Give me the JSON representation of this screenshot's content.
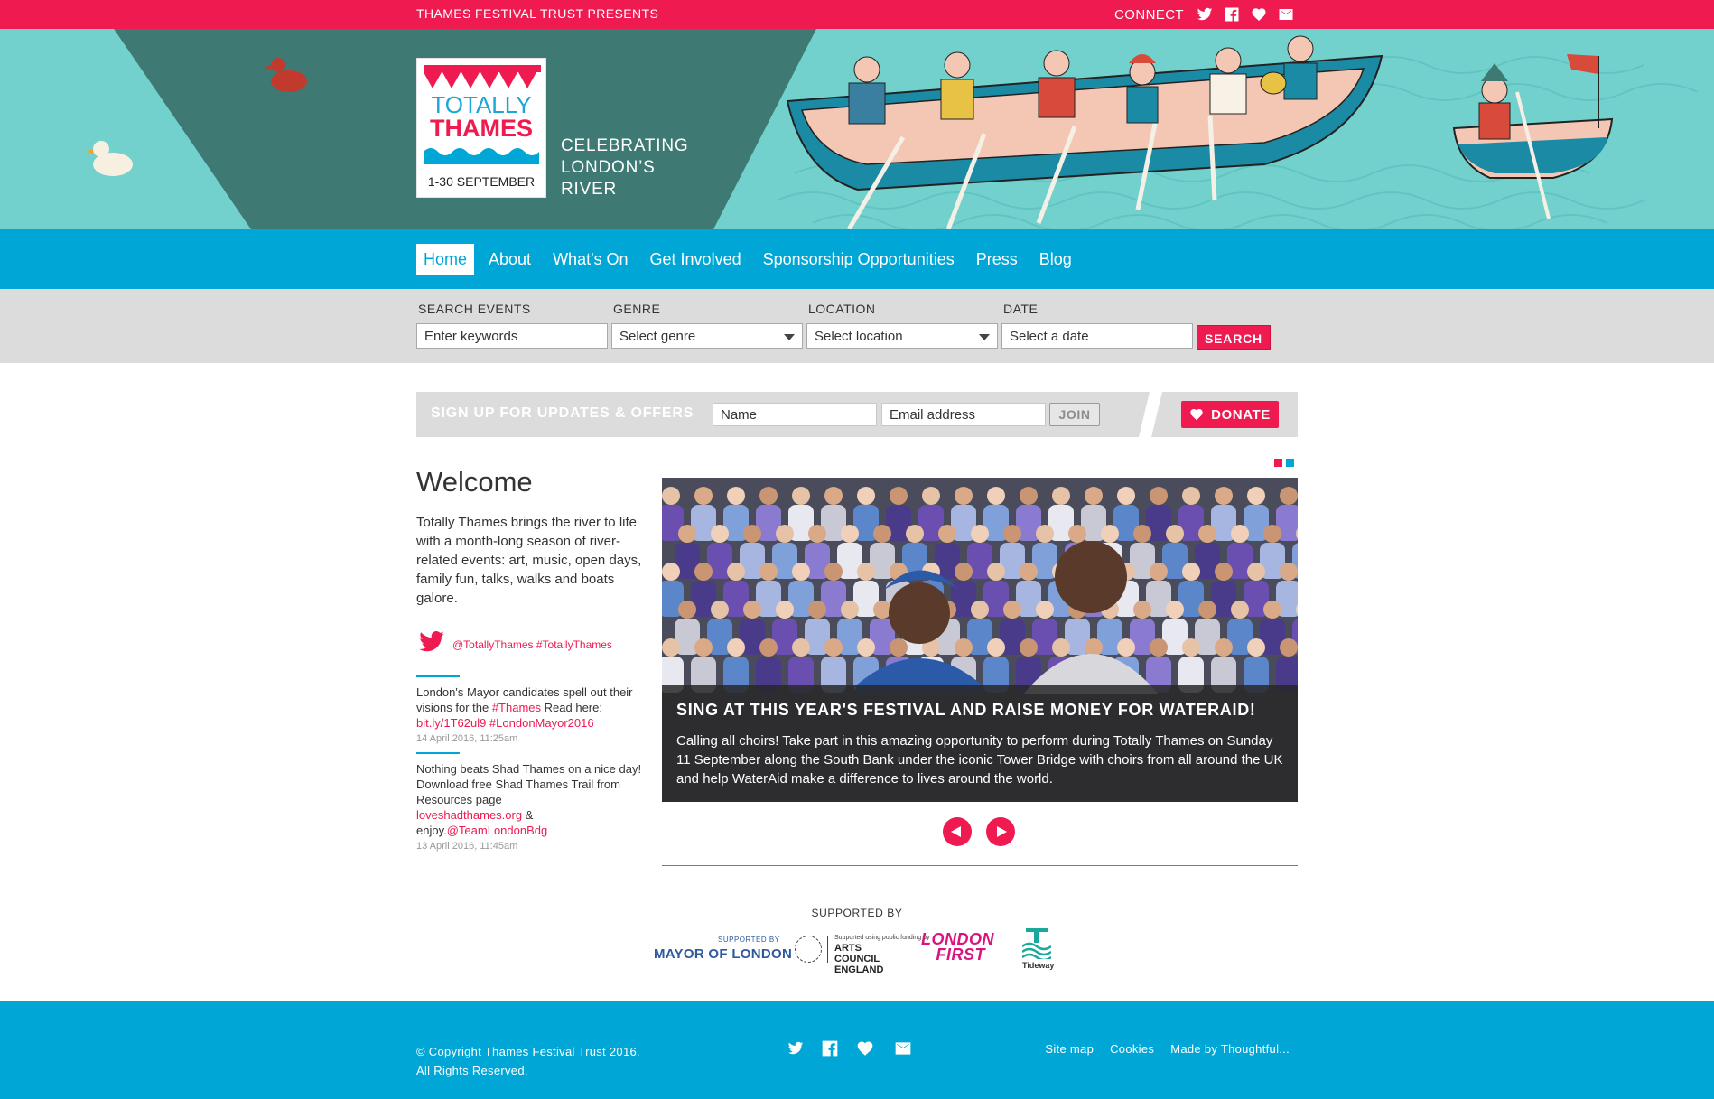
{
  "topbar": {
    "presents": "THAMES FESTIVAL TRUST PRESENTS",
    "connect_label": "CONNECT",
    "icons": [
      "twitter-icon",
      "facebook-icon",
      "heart-icon",
      "mail-icon"
    ]
  },
  "logo": {
    "line1": "TOTALLY",
    "line2": "THAMES",
    "dates": "1-30 SEPTEMBER"
  },
  "tagline": "CELEBRATING LONDON’S RIVER",
  "nav": {
    "items": [
      "Home",
      "About",
      "What's On",
      "Get Involved",
      "Sponsorship Opportunities",
      "Press",
      "Blog"
    ],
    "active": "Home"
  },
  "search": {
    "keywords_label": "SEARCH EVENTS",
    "keywords_placeholder": "Enter keywords",
    "genre_label": "GENRE",
    "genre_value": "Select genre",
    "location_label": "LOCATION",
    "location_value": "Select location",
    "date_label": "DATE",
    "date_placeholder": "Select a date",
    "button": "SEARCH"
  },
  "signup": {
    "title": "SIGN UP FOR UPDATES & OFFERS",
    "name_placeholder": "Name",
    "email_placeholder": "Email address",
    "join": "JOIN",
    "donate": "DONATE"
  },
  "welcome": {
    "title": "Welcome",
    "body": "Totally Thames brings the river to life with a month-long season of river-related events: art, music, open days, family fun, talks, walks and boats galore."
  },
  "twitter": {
    "handles": "@TotallyThames #TotallyThames",
    "tweets": [
      {
        "part1": "London's Mayor candidates spell out their visions for the ",
        "link1": "#Thames",
        "part2": " Read here: ",
        "link2": "bit.ly/1T62ul9 #LondonMayor2016",
        "date": "14 April 2016, 11:25am"
      },
      {
        "part1": "Nothing beats Shad Thames on a nice day! Download free Shad Thames Trail from Resources page ",
        "link1": "loveshadthames.org",
        "part2": " & enjoy.",
        "link2": "@TeamLondonBdg",
        "date": "13 April 2016, 11:45am"
      }
    ]
  },
  "carousel": {
    "dot_colors": [
      "#ef1a4f",
      "#00a7d6"
    ],
    "heading": "SING AT THIS YEAR'S FESTIVAL AND RAISE MONEY FOR WATERAID!",
    "text": "Calling all choirs! Take part in this amazing opportunity to perform during Totally Thames on Sunday 11 September along the South Bank under the iconic Tower Bridge with choirs from all around the UK and help WaterAid make a difference to lives around the world."
  },
  "supporters": {
    "label": "SUPPORTED BY",
    "mayor_small": "SUPPORTED BY",
    "mayor": "MAYOR OF LONDON",
    "ace_small": "Supported using public funding by",
    "ace_line1": "ARTS COUNCIL",
    "ace_line2": "ENGLAND",
    "london_first_1": "LONDON",
    "london_first_2": "FIRST",
    "tideway": "Tideway"
  },
  "footer": {
    "copyright_1": "© Copyright Thames Festival Trust 2016.",
    "copyright_2": "All Rights Reserved.",
    "links": [
      "Site map",
      "Cookies",
      "Made by Thoughtful..."
    ]
  },
  "colors": {
    "pink": "#ef1a4f",
    "blue": "#00a7d6",
    "teal": "#6fd0cc",
    "grey": "#dcdcdc"
  }
}
